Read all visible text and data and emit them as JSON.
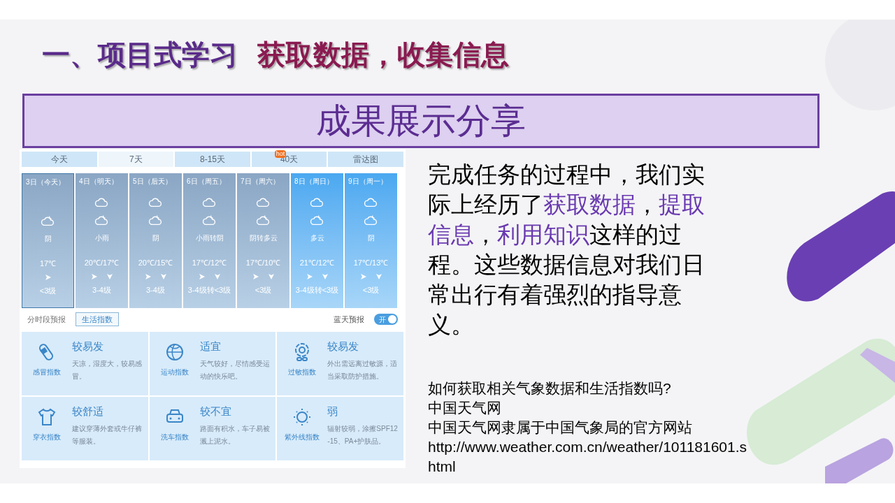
{
  "title": {
    "prefix": "一、项目式学习",
    "highlight": "获取数据，收集信息"
  },
  "banner": "成果展示分享",
  "weather": {
    "tabs": [
      {
        "label": "今天",
        "selected": false
      },
      {
        "label": "7天",
        "selected": true
      },
      {
        "label": "8-15天",
        "selected": false
      },
      {
        "label": "40天",
        "selected": false,
        "badge": "hot"
      },
      {
        "label": "雷达图",
        "selected": false
      }
    ],
    "days": [
      {
        "date": "3日（今天）",
        "selected": true,
        "highlighted": false,
        "night_only": true,
        "weather": "阴",
        "temp": "17℃",
        "wind": "<3级"
      },
      {
        "date": "4日（明天）",
        "selected": false,
        "highlighted": false,
        "night_only": false,
        "weather": "小雨",
        "temp": "20℃/17℃",
        "wind": "3-4级"
      },
      {
        "date": "5日（后天）",
        "selected": false,
        "highlighted": false,
        "night_only": false,
        "weather": "阴",
        "temp": "20℃/15℃",
        "wind": "3-4级"
      },
      {
        "date": "6日（周五）",
        "selected": false,
        "highlighted": false,
        "night_only": false,
        "weather": "小雨转阴",
        "temp": "17℃/12℃",
        "wind": "3-4级转<3级"
      },
      {
        "date": "7日（周六）",
        "selected": false,
        "highlighted": false,
        "night_only": false,
        "weather": "阴转多云",
        "temp": "17℃/10℃",
        "wind": "<3级"
      },
      {
        "date": "8日（周日）",
        "selected": false,
        "highlighted": true,
        "night_only": false,
        "weather": "多云",
        "temp": "21℃/12℃",
        "wind": "3-4级转<3级"
      },
      {
        "date": "9日（周一）",
        "selected": false,
        "highlighted": true,
        "night_only": false,
        "weather": "阴",
        "temp": "17℃/13℃",
        "wind": "<3级"
      }
    ],
    "subtabs": [
      {
        "label": "分时段预报",
        "selected": false
      },
      {
        "label": "生活指数",
        "selected": true
      }
    ],
    "toggle": {
      "label": "蓝天预报",
      "on": true,
      "text": "开"
    },
    "indices": [
      {
        "kind": "pill",
        "name": "感冒指数",
        "level": "较易发",
        "desc": "天凉，湿度大，较易感冒。"
      },
      {
        "kind": "ball",
        "name": "运动指数",
        "level": "适宜",
        "desc": "天气较好，尽情感受运动的快乐吧。"
      },
      {
        "kind": "flower",
        "name": "过敏指数",
        "level": "较易发",
        "desc": "外出需远离过敏源，适当采取防护措施。"
      },
      {
        "kind": "shirt",
        "name": "穿衣指数",
        "level": "较舒适",
        "desc": "建议穿薄外套或牛仔裤等服装。"
      },
      {
        "kind": "car",
        "name": "洗车指数",
        "level": "较不宜",
        "desc": "路面有积水，车子易被溅上泥水。"
      },
      {
        "kind": "sun",
        "name": "紫外线指数",
        "level": "弱",
        "desc": "辐射较弱，涂擦SPF12-15、PA+护肤品。"
      }
    ]
  },
  "summary": [
    {
      "text": "完成任务的过程中，我们实际上经历了",
      "highlight": false
    },
    {
      "text": "获取数据",
      "highlight": true
    },
    {
      "text": "，",
      "highlight": false
    },
    {
      "text": "提取信息",
      "highlight": true
    },
    {
      "text": "，",
      "highlight": false
    },
    {
      "text": "利用知识",
      "highlight": true
    },
    {
      "text": "这样的过程。这些数据信息对我们日常出行有着强烈的指导意义。",
      "highlight": false
    }
  ],
  "notes": [
    "如何获取相关气象数据和生活指数吗?",
    "中国天气网",
    "中国天气网隶属于中国气象局的官方网站",
    "http://www.weather.com.cn/weather/101181601.shtml"
  ]
}
